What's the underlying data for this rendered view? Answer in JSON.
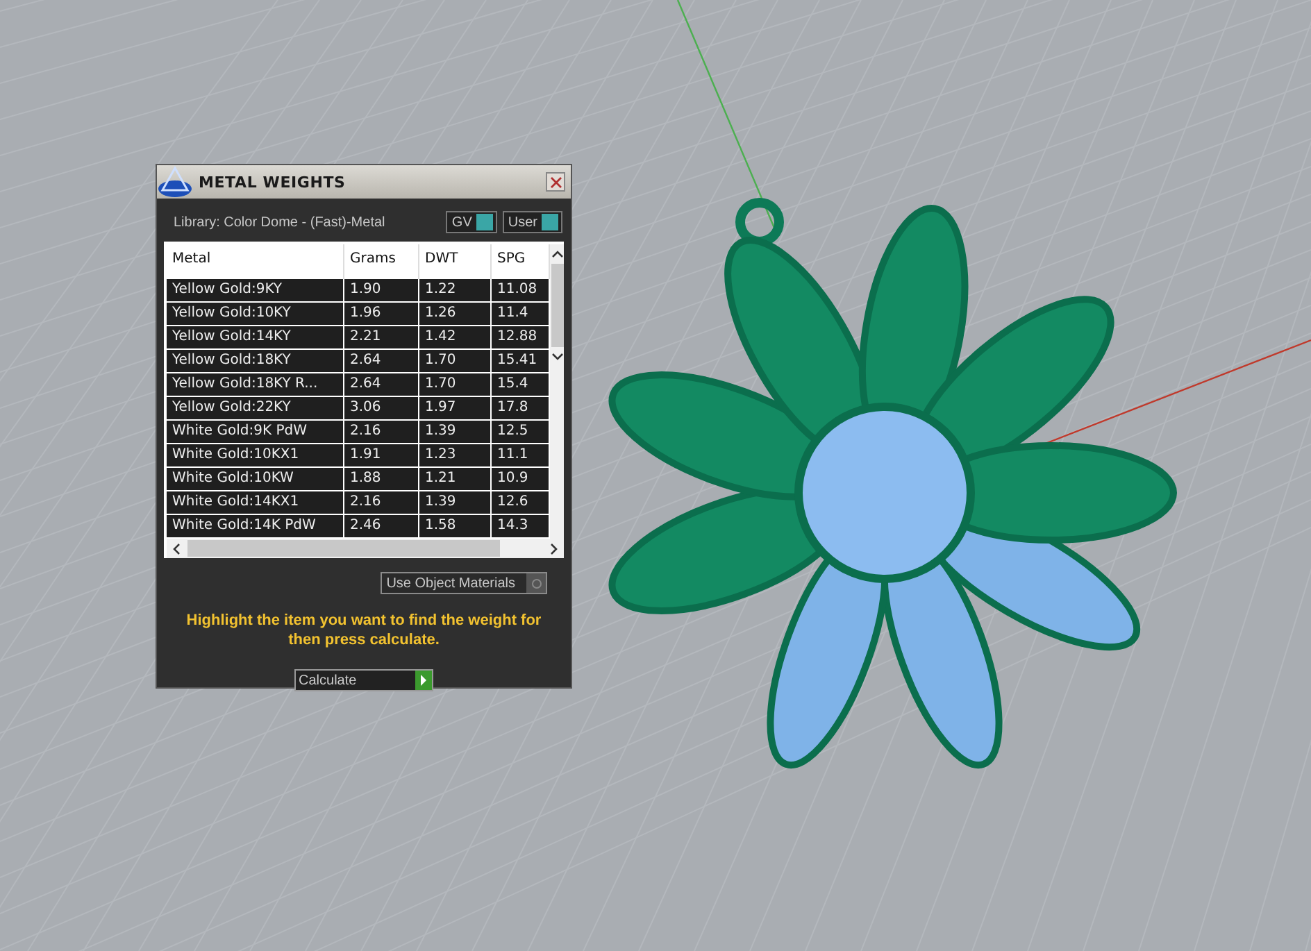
{
  "window": {
    "title": "METAL WEIGHTS"
  },
  "library": "Library: Color Dome - (Fast)-Metal",
  "toggles": [
    {
      "label": "GV",
      "on": true
    },
    {
      "label": "User",
      "on": true
    }
  ],
  "table": {
    "columns": [
      "Metal",
      "Grams",
      "DWT",
      "SPG"
    ],
    "rows": [
      {
        "cells": [
          "Yellow Gold:9KY",
          "1.90",
          "1.22",
          "11.08"
        ],
        "selected": false
      },
      {
        "cells": [
          "Yellow Gold:10KY",
          "1.96",
          "1.26",
          "11.4"
        ],
        "selected": false
      },
      {
        "cells": [
          "Yellow Gold:14KY",
          "2.21",
          "1.42",
          "12.88"
        ],
        "selected": false
      },
      {
        "cells": [
          "Yellow Gold:18KY",
          "2.64",
          "1.70",
          "15.41"
        ],
        "selected": false
      },
      {
        "cells": [
          "Yellow Gold:18KY R...",
          "2.64",
          "1.70",
          "15.4"
        ],
        "selected": false
      },
      {
        "cells": [
          "Yellow Gold:22KY",
          "3.06",
          "1.97",
          "17.8"
        ],
        "selected": false
      },
      {
        "cells": [
          "White Gold:9K PdW",
          "2.16",
          "1.39",
          "12.5"
        ],
        "selected": false
      },
      {
        "cells": [
          "White Gold:10KX1",
          "1.91",
          "1.23",
          "11.1"
        ],
        "selected": false
      },
      {
        "cells": [
          "White Gold:10KW",
          "1.88",
          "1.21",
          "10.9"
        ],
        "selected": false
      },
      {
        "cells": [
          "White Gold:14KX1",
          "2.16",
          "1.39",
          "12.6"
        ],
        "selected": false
      },
      {
        "cells": [
          "White Gold:14K PdW",
          "2.46",
          "1.58",
          "14.3"
        ],
        "selected": false
      }
    ]
  },
  "use_object_materials": {
    "label": "Use Object Materials",
    "checked": false
  },
  "hint": "Highlight the item you want to find the weight for then press calculate.",
  "calculate_button": "Calculate"
}
